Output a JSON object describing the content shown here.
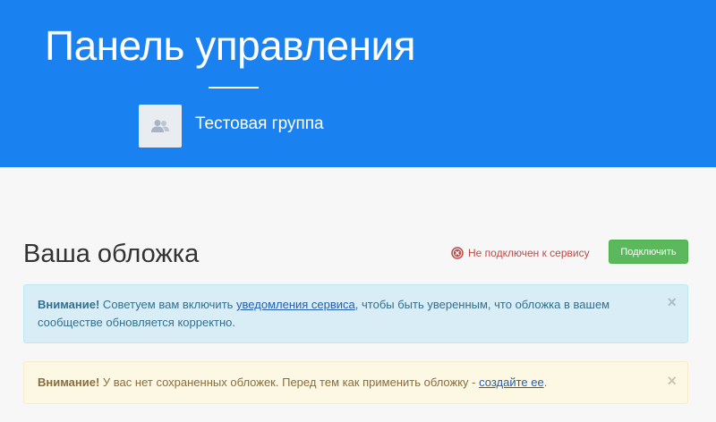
{
  "header": {
    "title": "Панель управления",
    "group_name": "Тестовая группа",
    "group_icon": "users-icon",
    "background_color": "#1a82f0"
  },
  "cover": {
    "title": "Ваша обложка",
    "status_text": "Не подключен к сервису",
    "status_icon": "close-circle-icon",
    "status_color": "#b94a48",
    "connect_label": "Подключить",
    "connect_color": "#5cb85c"
  },
  "alerts": {
    "info": {
      "strong": "Внимание!",
      "text_before": " Советуем вам включить ",
      "link": "уведомления сервиса",
      "text_after": ", чтобы быть уверенным, что обложка в вашем сообществе обновляется корректно.",
      "close": "×"
    },
    "warning": {
      "strong": "Внимание!",
      "text_before": " У вас нет сохраненных обложек. Перед тем как применить обложку - ",
      "link": "создайте ее",
      "text_after": ".",
      "close": "×"
    }
  }
}
